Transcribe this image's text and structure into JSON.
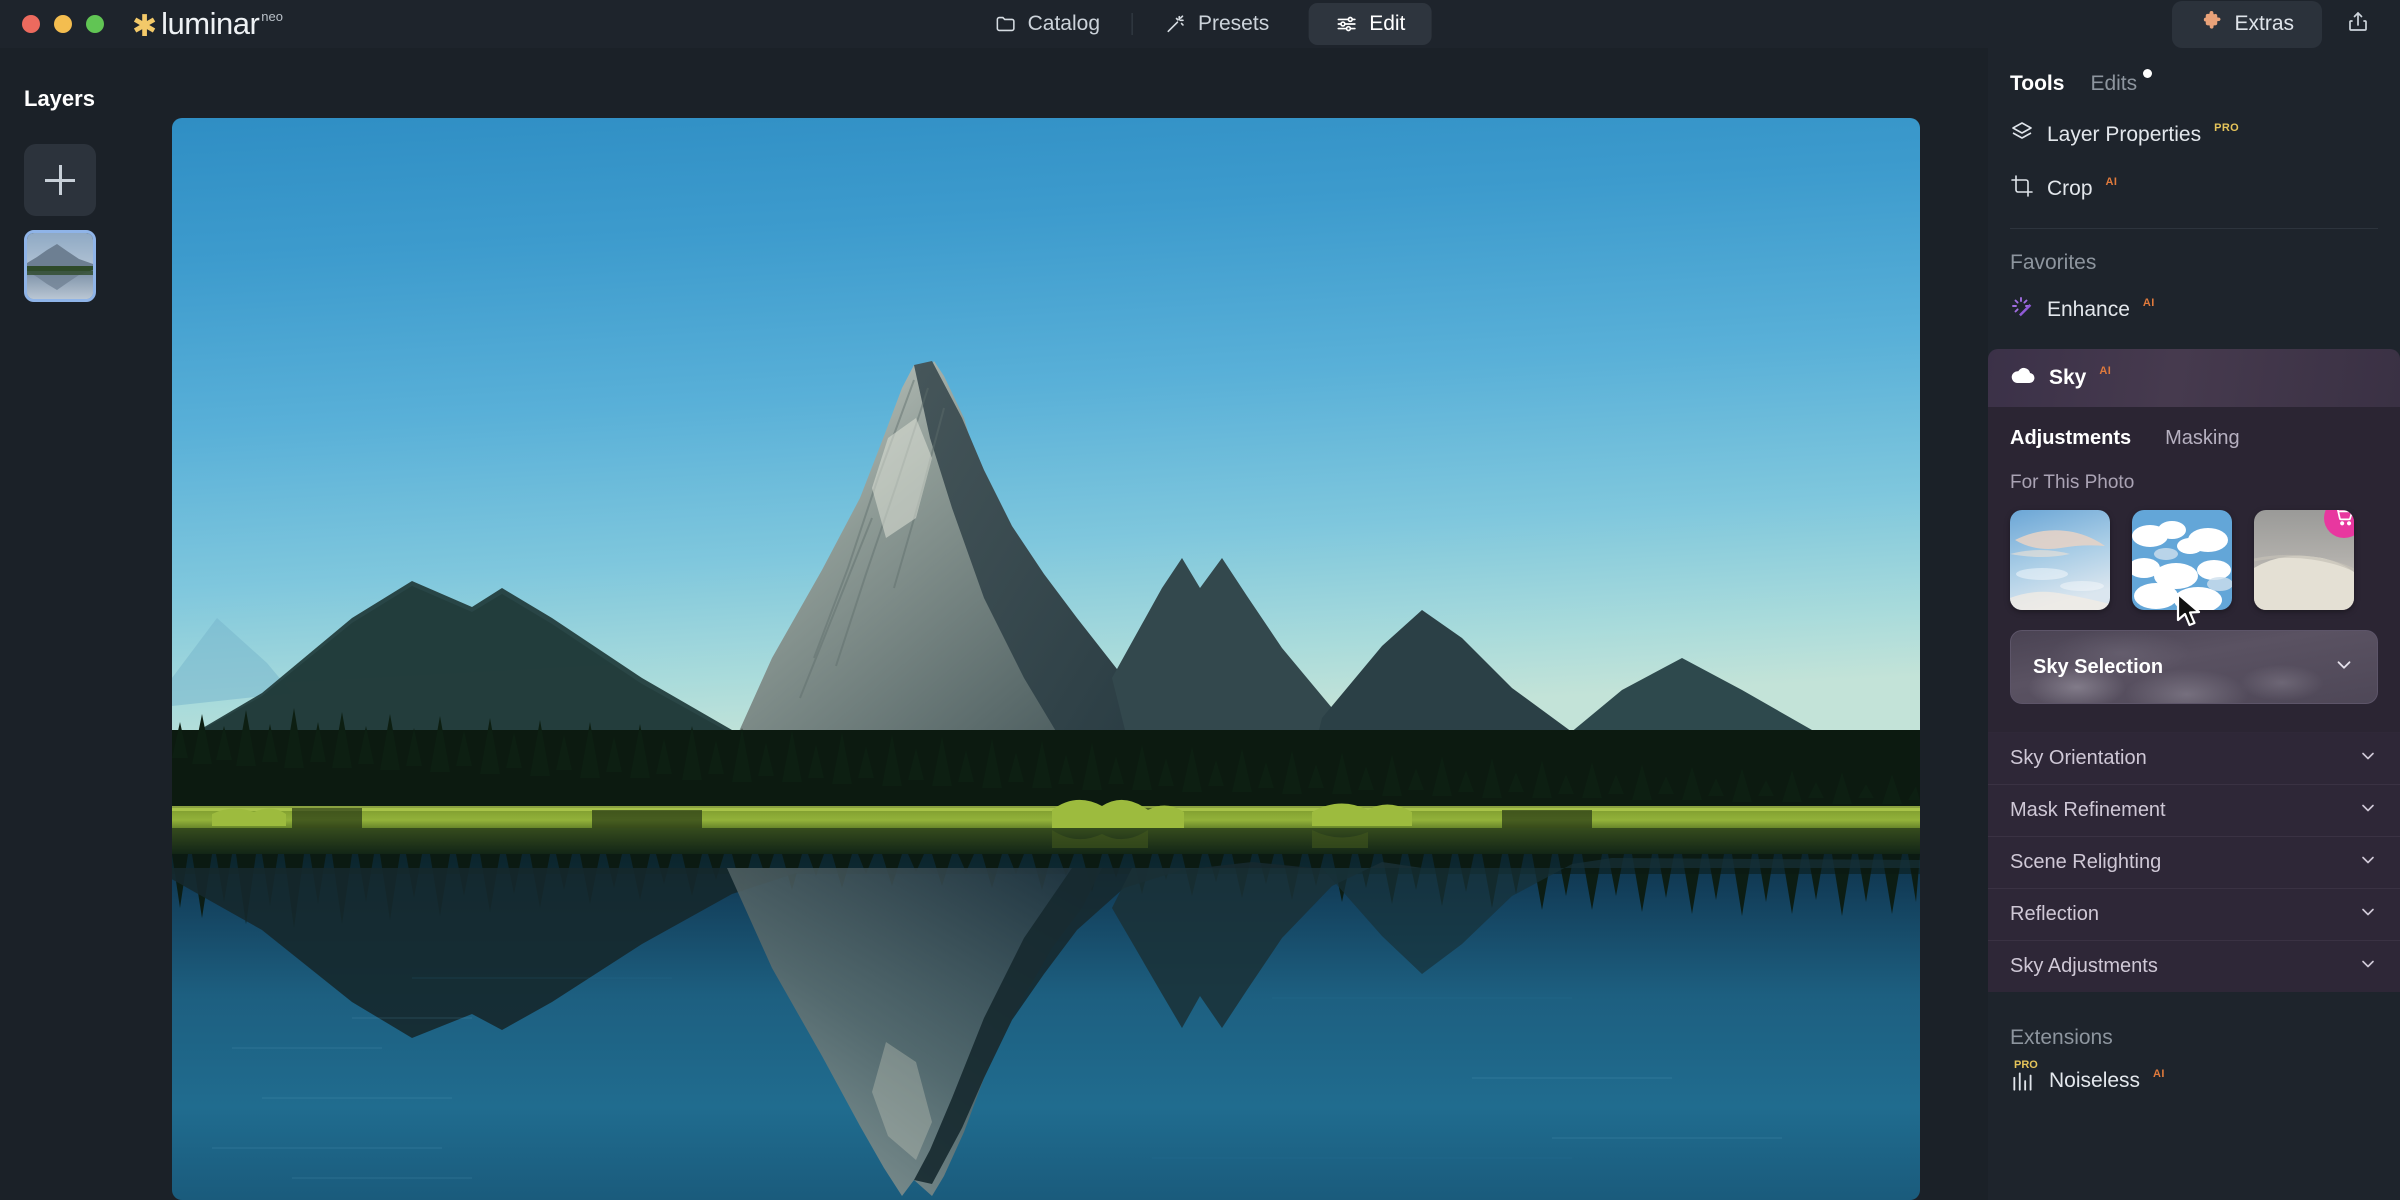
{
  "window": {
    "traffic_lights": [
      "close",
      "minimize",
      "zoom"
    ],
    "brand_name": "luminar",
    "brand_superscript": "neo",
    "brand_icon": "star-burst-icon"
  },
  "topnav": {
    "items": [
      {
        "label": "Catalog",
        "icon": "folder-icon",
        "active": false
      },
      {
        "label": "Presets",
        "icon": "magic-wand-icon",
        "active": false
      },
      {
        "label": "Edit",
        "icon": "sliders-icon",
        "active": true
      }
    ]
  },
  "topright": {
    "extras_label": "Extras",
    "extras_icon": "puzzle-piece-icon",
    "share_icon": "share-icon"
  },
  "left_panel": {
    "title": "Layers",
    "add_button_icon": "plus-icon",
    "layer_thumbnail": "mountain-lake-layer-thumbnail"
  },
  "right_panel": {
    "tabs": [
      {
        "label": "Tools",
        "active": true,
        "dot": false
      },
      {
        "label": "Edits",
        "active": false,
        "dot": true
      }
    ],
    "tools": [
      {
        "label": "Layer Properties",
        "badge": "PRO",
        "badge_type": "pro",
        "icon": "layers-icon"
      },
      {
        "label": "Crop",
        "badge": "AI",
        "badge_type": "ai",
        "icon": "crop-icon"
      }
    ],
    "favorites_title": "Favorites",
    "favorites": [
      {
        "label": "Enhance",
        "badge": "AI",
        "badge_type": "ai",
        "icon": "sparkle-icon"
      }
    ],
    "sky": {
      "title": "Sky",
      "badge": "AI",
      "icon": "cloud-icon",
      "tabs": [
        {
          "label": "Adjustments",
          "active": true
        },
        {
          "label": "Masking",
          "active": false
        }
      ],
      "thumbs_title": "For This Photo",
      "thumbs": [
        {
          "name": "cirrus-sky-thumbnail",
          "locked": false
        },
        {
          "name": "cumulus-sky-thumbnail",
          "locked": false
        },
        {
          "name": "foggy-sky-thumbnail",
          "locked": true,
          "badge_icon": "cart-icon"
        }
      ],
      "selection_label": "Sky Selection",
      "selection_chevron": "chevron-down-icon",
      "accordions": [
        {
          "label": "Sky Orientation",
          "chevron": "chevron-down-icon"
        },
        {
          "label": "Mask Refinement",
          "chevron": "chevron-down-icon"
        },
        {
          "label": "Scene Relighting",
          "chevron": "chevron-down-icon"
        },
        {
          "label": "Reflection",
          "chevron": "chevron-down-icon"
        },
        {
          "label": "Sky Adjustments",
          "chevron": "chevron-down-icon"
        }
      ]
    },
    "extensions_title": "Extensions",
    "extensions": [
      {
        "label": "Noiseless",
        "badge": "AI",
        "badge_type": "ai",
        "icon": "noiseless-icon",
        "icon_badge": "PRO"
      }
    ]
  },
  "canvas": {
    "image_name": "mountain-lake-reflection-photo"
  },
  "colors": {
    "app_bg": "#1b2128",
    "panel_bg": "#1e242c",
    "accent_pink": "#e8379f",
    "badge_ai": "#e07a3c",
    "badge_pro": "#e5c45a",
    "selection_blue": "#8fb4e8",
    "brand_gold": "#f3c969",
    "sky_panel": "#2b2533"
  }
}
